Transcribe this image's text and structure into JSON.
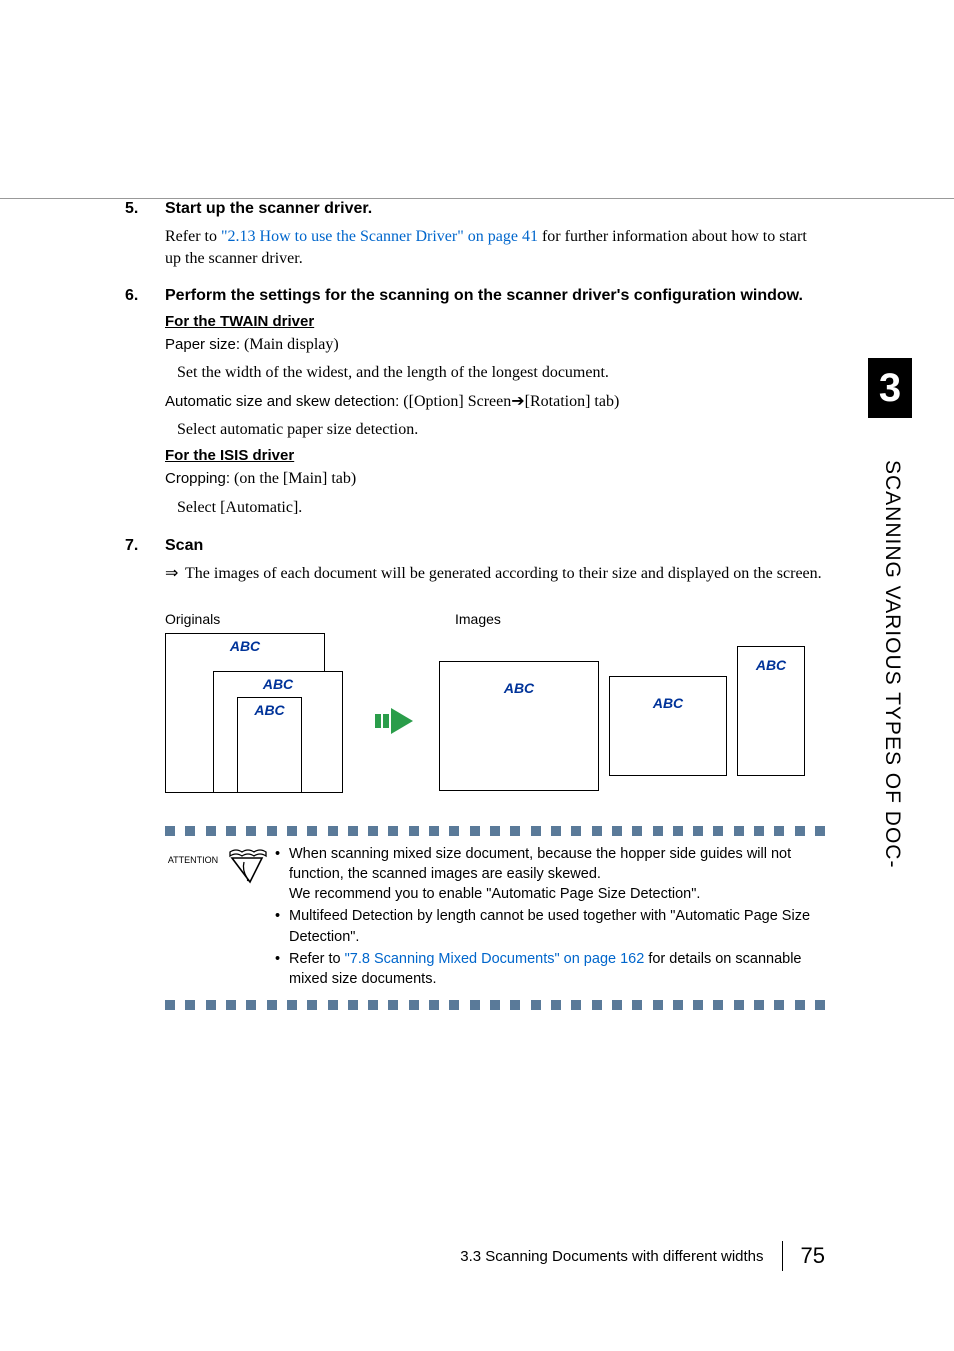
{
  "chapter_number": "3",
  "side_text": "SCANNING VARIOUS TYPES OF DOC-",
  "steps": [
    {
      "num": "5.",
      "title": "Start up the scanner driver.",
      "paragraphs": [
        {
          "prefix": "Refer to ",
          "link": "\"2.13 How to use the Scanner Driver\" on page 41",
          "suffix": " for further information about how to start up the scanner driver."
        }
      ]
    },
    {
      "num": "6.",
      "title": "Perform the settings for the scanning on the scanner driver's configuration window.",
      "sections": [
        {
          "heading": "For the TWAIN driver",
          "lines": [
            {
              "label": "Paper size:",
              "desc": " (Main display)"
            },
            {
              "indent": true,
              "text": "Set the width of the widest, and the length of the longest document."
            },
            {
              "label": "Automatic size and skew detection:",
              "desc": " ([Option] Screen➔[Rotation] tab)"
            },
            {
              "indent": true,
              "text": "Select automatic paper size detection."
            }
          ]
        },
        {
          "heading": "For the ISIS driver",
          "lines": [
            {
              "label": "Cropping:",
              "desc": " (on the [Main] tab)"
            },
            {
              "indent": true,
              "text": "Select [Automatic]."
            }
          ]
        }
      ]
    },
    {
      "num": "7.",
      "title": "Scan",
      "result": "The images of each document will be generated according to their size and displayed on the screen."
    }
  ],
  "diagram": {
    "originals_label": "Originals",
    "images_label": "Images",
    "abc": "ABC"
  },
  "attention": {
    "label": "ATTENTION",
    "items": [
      "When scanning mixed size document, because the hopper side guides will not function, the scanned images are easily skewed.\nWe recommend you to enable \"Automatic Page Size Detection\".",
      "Multifeed Detection by length cannot be used together with \"Automatic Page Size Detection\".",
      {
        "prefix": "Refer to ",
        "link": "\"7.8 Scanning Mixed Documents\" on page 162",
        "suffix": "  for details on scannable mixed size documents."
      }
    ]
  },
  "footer": {
    "section": "3.3 Scanning Documents with different widths",
    "page": "75"
  }
}
